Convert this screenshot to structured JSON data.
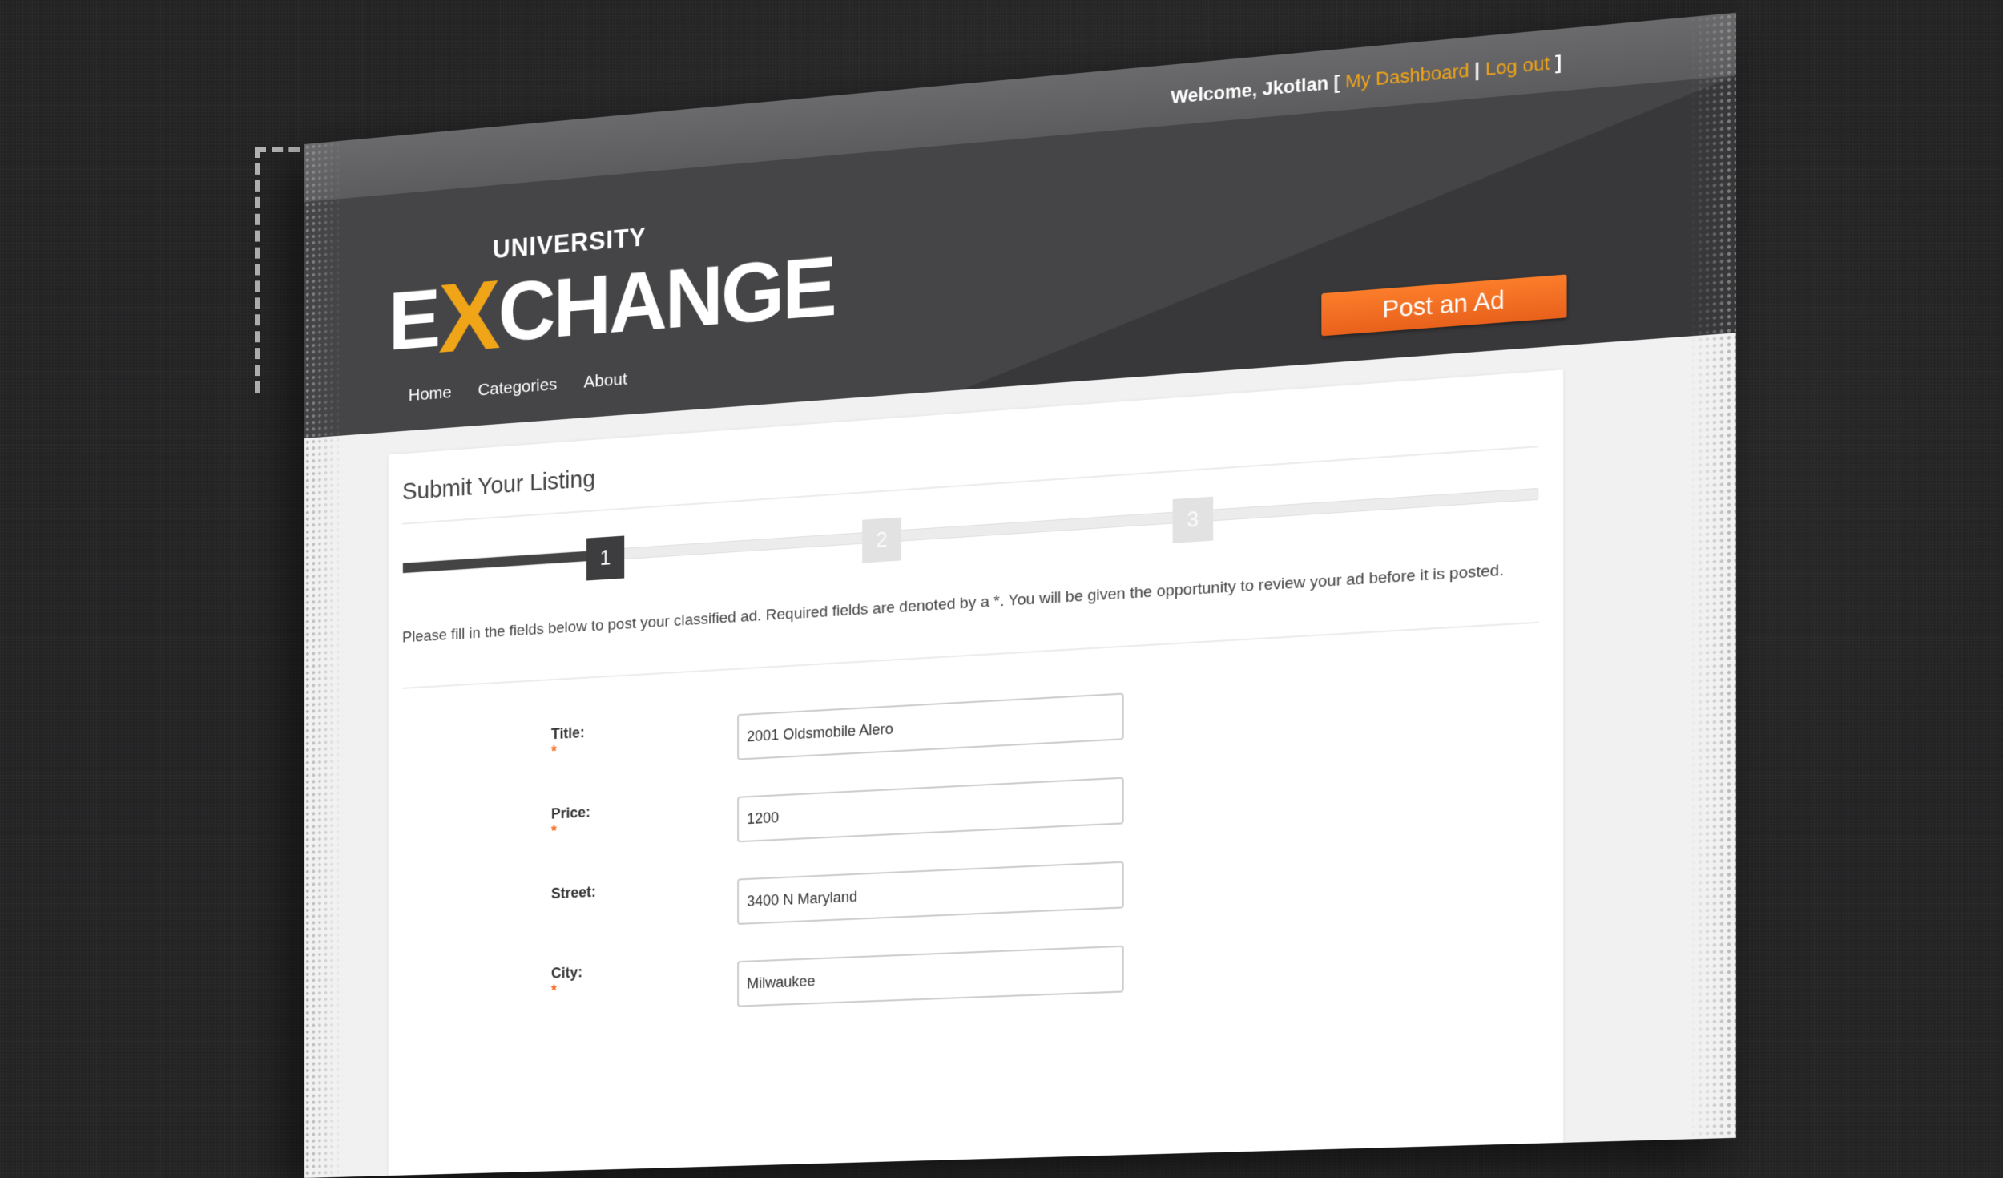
{
  "topbar": {
    "welcome_text": "Welcome, Jkotlan",
    "bracket_open": "[",
    "dashboard_link": "My Dashboard",
    "separator": "|",
    "logout_link": "Log out",
    "bracket_close": "]"
  },
  "logo": {
    "small": "UNIVERSITY",
    "big_prefix": "E",
    "big_x": "X",
    "big_suffix": "CHANGE"
  },
  "nav": {
    "items": [
      "Home",
      "Categories",
      "About"
    ]
  },
  "post_ad_label": "Post an Ad",
  "form": {
    "title": "Submit Your Listing",
    "progress": {
      "current_step": 1,
      "total_steps": 3,
      "fraction": 0.19
    },
    "steps": [
      "1",
      "2",
      "3"
    ],
    "instructions": "Please fill in the fields below to post your classified ad. Required fields are denoted by a *. You will be given the opportunity to review your ad before it is posted.",
    "required_marker": "*",
    "fields": [
      {
        "label": "Title:",
        "required": true,
        "value": "2001 Oldsmobile Alero"
      },
      {
        "label": "Price:",
        "required": true,
        "value": "1200"
      },
      {
        "label": "Street:",
        "required": false,
        "value": "3400 N Maryland"
      },
      {
        "label": "City:",
        "required": true,
        "value": "Milwaukee"
      }
    ]
  },
  "colors": {
    "accent_orange": "#f0a418",
    "button_orange": "#f26a1b",
    "header_dark": "#454547"
  }
}
